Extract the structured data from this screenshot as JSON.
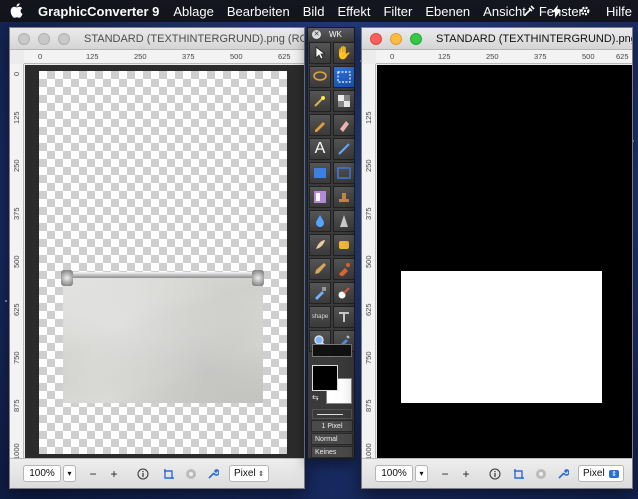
{
  "menubar": {
    "app_name": "GraphicConverter 9",
    "items": [
      "Ablage",
      "Bearbeiten",
      "Bild",
      "Effekt",
      "Filter",
      "Ebenen",
      "Ansicht",
      "Fenster"
    ],
    "help": "Hilfe"
  },
  "left_window": {
    "title": "STANDARD (TEXTHINTERGRUND).png (RGB+Alpha)",
    "h_ruler": [
      "0",
      "125",
      "250",
      "375",
      "500",
      "625"
    ],
    "v_ruler": [
      "0",
      "125",
      "250",
      "375",
      "500",
      "625",
      "750",
      "875",
      "1000"
    ],
    "zoom": "100%",
    "unit": "Pixel"
  },
  "right_window": {
    "title": "STANDARD (TEXTHINTERGRUND).png(Alphakan…",
    "h_ruler": [
      "0",
      "125",
      "250",
      "375",
      "500",
      "625"
    ],
    "v_ruler": [
      "125",
      "250",
      "375",
      "500",
      "625",
      "750",
      "875",
      "1000"
    ],
    "zoom": "100%",
    "unit": "Pixel"
  },
  "palette": {
    "title": "WK",
    "brush_size": "1 Pixel",
    "blend_mode": "Normal",
    "mask_mode": "Keines"
  }
}
